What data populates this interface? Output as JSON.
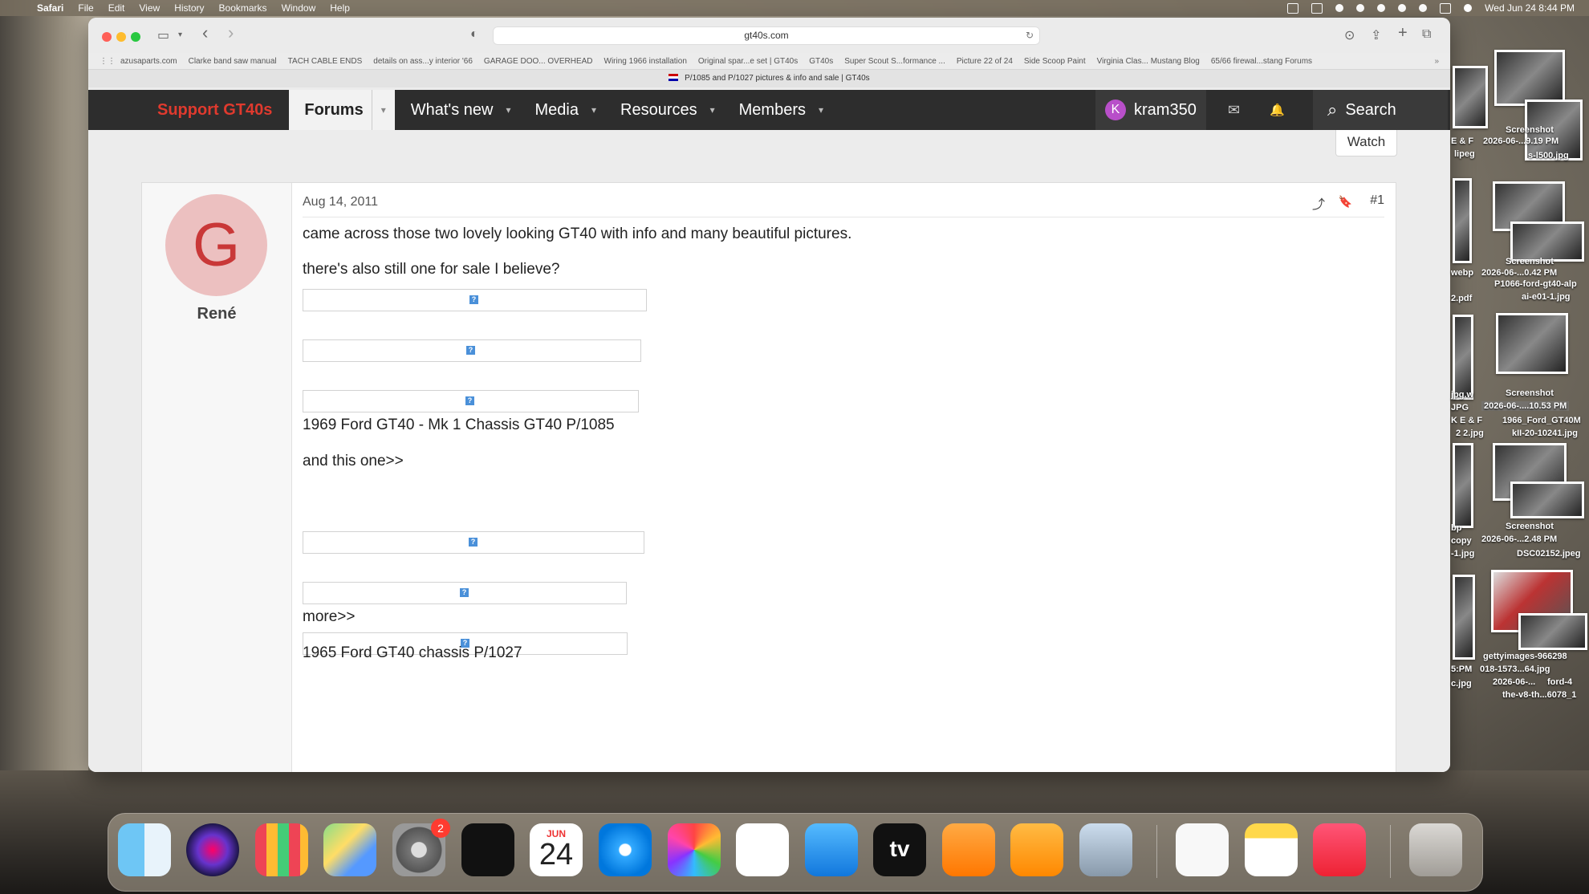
{
  "menubar": {
    "apple": "",
    "items": [
      "Safari",
      "File",
      "Edit",
      "View",
      "History",
      "Bookmarks",
      "Window",
      "Help"
    ],
    "clock": "Wed Jun 24  8:44 PM"
  },
  "browser": {
    "url": "gt40s.com",
    "bookmarks": [
      "azusaparts.com",
      "Clarke band saw manual",
      "TACH CABLE ENDS",
      "details on ass...y interior '66",
      "GARAGE DOO... OVERHEAD",
      "Wiring 1966 installation",
      "Original spar...e set | GT40s",
      "GT40s",
      "Super Scout S...formance ...",
      "Picture 22 of 24",
      "Side Scoop Paint",
      "Virginia Clas... Mustang Blog",
      "65/66 firewal...stang Forums"
    ],
    "tab_title": "P/1085 and P/1027 pictures & info and sale | GT40s"
  },
  "nav": {
    "support": "Support GT40s",
    "forums": "Forums",
    "whats_new": "What's new",
    "media": "Media",
    "resources": "Resources",
    "members": "Members",
    "user_initial": "K",
    "username": "kram350",
    "search": "Search"
  },
  "thread": {
    "watch": "Watch"
  },
  "post": {
    "avatar_letter": "G",
    "author": "René",
    "date": "Aug 14, 2011",
    "number": "#1",
    "p1": "came across those two lovely looking GT40 with info and many beautiful pictures.",
    "p2": "there's also still one for sale I believe?",
    "p3": "1969 Ford GT40 - Mk 1 Chassis GT40 P/1085",
    "p4": "and this one>>",
    "p5": "more>>",
    "p6": "1965 Ford GT40 chassis P/1027",
    "image_glyph": "?"
  },
  "desktop": {
    "labels": [
      "Screenshot",
      "2026-06-...9.19 PM",
      "s-l500.jpg",
      "E & F",
      "lipeg",
      "Screenshot",
      "2026-06-...0.42 PM",
      "webp",
      "P1066-ford-gt40-alp",
      "ai-e01-1.jpg",
      "2.pdf",
      "jpg.w",
      "JPG",
      "Screenshot",
      "2026-06-....10.53 PM",
      "K E & F",
      "2 2.jpg",
      "1966_Ford_GT40M",
      "kII-20-10241.jpg",
      "bp",
      "copy",
      "Screenshot",
      "2026-06-...2.48 PM",
      "-1.jpg",
      "DSC02152.jpeg",
      "gettyimages-966298",
      "018-1573...64.jpg",
      "2026-06-...",
      "ford-4",
      "the-v8-th...6078_1",
      "5:PM",
      "c.jpg"
    ]
  },
  "dock": {
    "calendar_month": "JUN",
    "calendar_day": "24",
    "settings_badge": "2",
    "tv_label": "tv"
  },
  "icons": {
    "back": "‹",
    "forward": "›",
    "caret": "▾",
    "mail": "✉",
    "bell": "🔔",
    "search": "⌕",
    "share": "⤴",
    "bookmark": "🔖",
    "reload": "↻",
    "more": "»"
  }
}
